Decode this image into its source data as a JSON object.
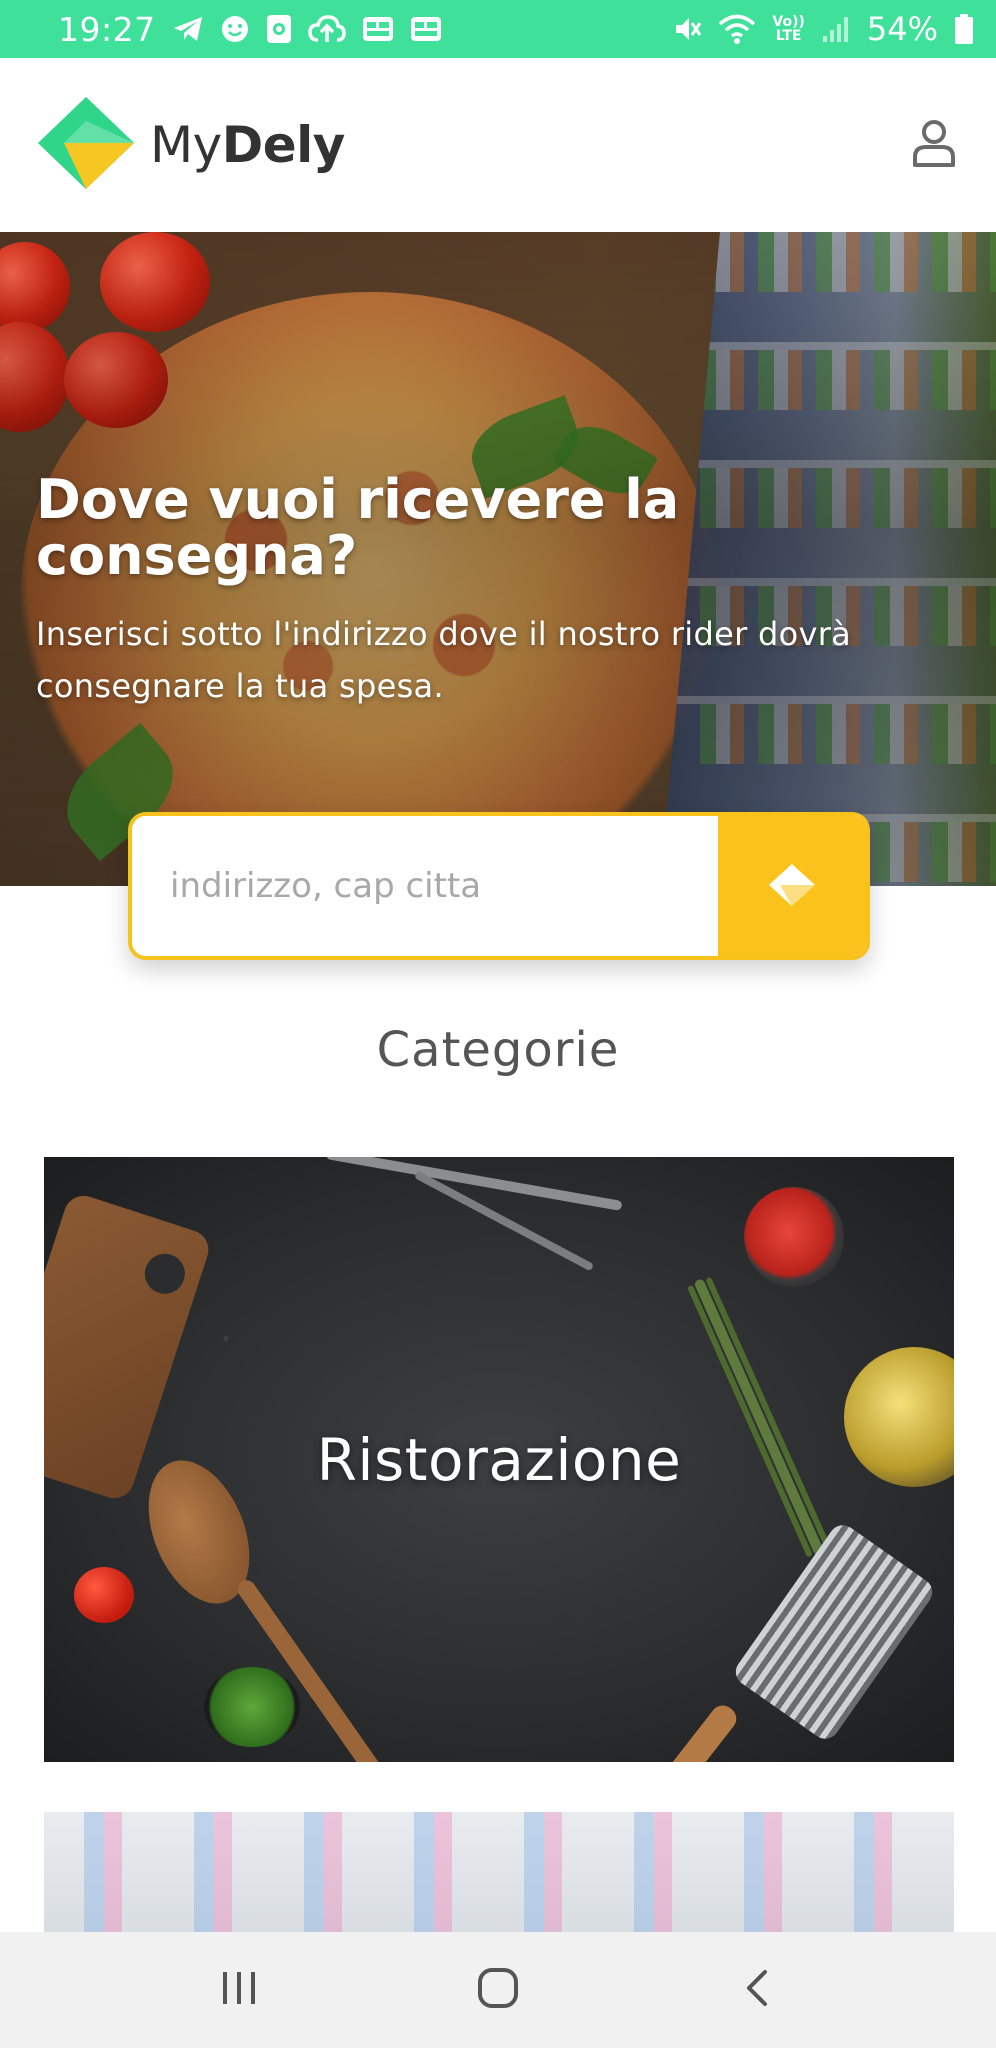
{
  "status_bar": {
    "time": "19:27",
    "battery": "54%",
    "network_label_top": "Vo))",
    "network_label_bottom": "LTE"
  },
  "header": {
    "logo_text_light": "My",
    "logo_text_bold": "Dely",
    "profile_icon": "user-icon"
  },
  "hero": {
    "title": "Dove vuoi ricevere la consegna?",
    "subtitle": "Inserisci sotto l'indirizzo dove il nostro rider dovrà consegnare la tua spesa."
  },
  "search": {
    "placeholder": "indirizzo, cap citta",
    "value": "",
    "button_icon": "mydely-diamond-icon"
  },
  "categories": {
    "title": "Categorie",
    "items": [
      {
        "label": "Ristorazione"
      },
      {
        "label": ""
      }
    ]
  },
  "colors": {
    "brand_green": "#3ee09a",
    "accent_yellow": "#fbc21b"
  }
}
